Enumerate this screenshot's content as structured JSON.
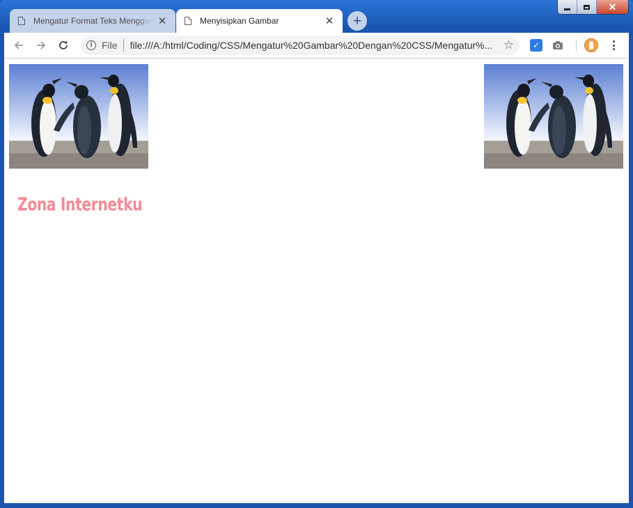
{
  "browser": {
    "tabs": [
      {
        "title": "Mengatur Format Teks Menggunakan CSS",
        "active": false
      },
      {
        "title": "Menyisipkan Gambar",
        "active": true
      }
    ],
    "omnibox": {
      "scheme_label": "File",
      "url": "file:///A:/html/Coding/CSS/Mengatur%20Gambar%20Dengan%20CSS/Mengatur%..."
    },
    "icons": {
      "back": "arrow-left-icon",
      "forward": "arrow-right-icon",
      "reload": "reload-icon",
      "info": "info-icon",
      "bookmark": "star-icon",
      "extension_1": "checkbox-extension-icon",
      "extension_2": "camera-icon",
      "profile": "profile-avatar-icon",
      "menu": "kebab-menu-icon"
    }
  },
  "page": {
    "images": [
      {
        "subject": "penguins",
        "position": "left"
      },
      {
        "subject": "penguins",
        "position": "right"
      }
    ],
    "heading": "Zona Internetku",
    "heading_color": "#f48a96"
  }
}
